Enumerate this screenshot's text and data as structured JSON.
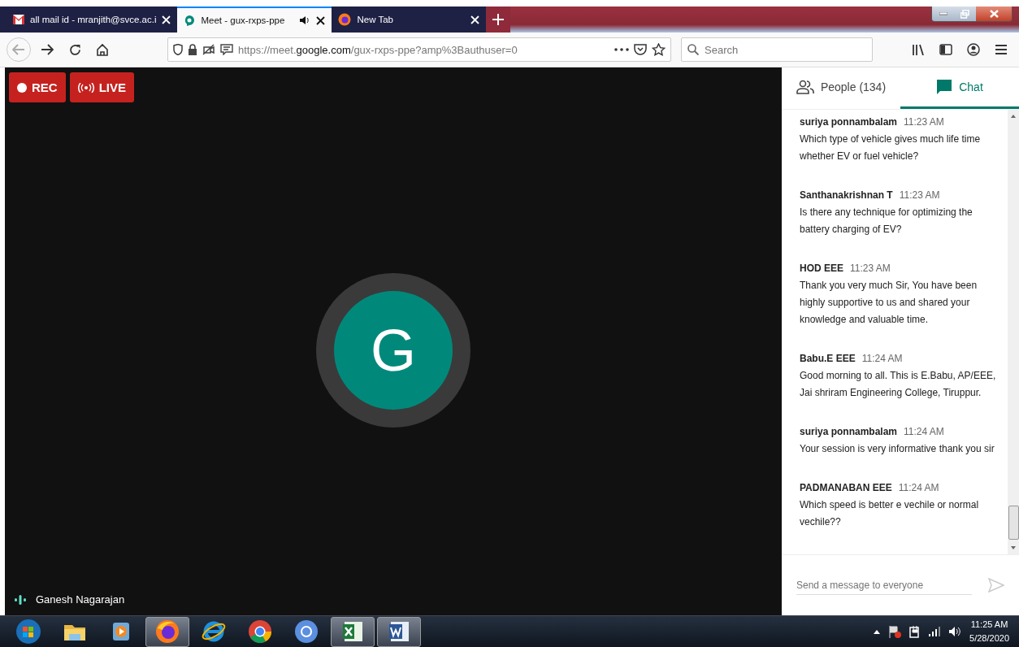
{
  "browser": {
    "tabs": [
      {
        "title": "all mail id - mranjith@svce.ac.i",
        "kind": "mail",
        "selected": false,
        "audio": false
      },
      {
        "title": "Meet - gux-rxps-ppe",
        "kind": "meet",
        "selected": true,
        "audio": true
      },
      {
        "title": "New Tab",
        "kind": "fox",
        "selected": false,
        "audio": false
      }
    ],
    "url": "https://meet.**google.com**/gux-rxps-ppe?amp%3Bauthuser=0",
    "search": {
      "placeholder": "Search"
    }
  },
  "meeting": {
    "rec_label": "REC",
    "live_label": "LIVE",
    "avatar_letter": "G",
    "speaker": "Ganesh Nagarajan"
  },
  "side_panel": {
    "tabs": [
      {
        "label": "People (134)",
        "kind": "people",
        "selected": false
      },
      {
        "label": "Chat",
        "kind": "chat",
        "selected": true
      }
    ],
    "messages": [
      {
        "sender": "suriya ponnambalam",
        "time": "11:23 AM",
        "text": "Which type of vehicle gives much life time whether EV or fuel vehicle?"
      },
      {
        "sender": "Santhanakrishnan T",
        "time": "11:23 AM",
        "text": "Is there any technique for optimizing the battery charging of EV?"
      },
      {
        "sender": "HOD EEE",
        "time": "11:23 AM",
        "text": "Thank you very much Sir, You have been highly supportive to us and shared your knowledge and valuable time."
      },
      {
        "sender": "Babu.E EEE",
        "time": "11:24 AM",
        "text": "Good morning to all. This is E.Babu, AP/EEE, Jai shriram Engineering College, Tiruppur."
      },
      {
        "sender": "suriya ponnambalam",
        "time": "11:24 AM",
        "text": "Your session is very informative thank you sir"
      },
      {
        "sender": "PADMANABAN EEE",
        "time": "11:24 AM",
        "text": "Which speed is better e vechile or normal vechile??"
      }
    ],
    "composer": {
      "placeholder": "Send a message to everyone"
    }
  },
  "taskbar": {
    "apps": [
      {
        "kind": "start",
        "running": false
      },
      {
        "kind": "folder",
        "running": false
      },
      {
        "kind": "player",
        "running": false
      },
      {
        "kind": "fox",
        "running": true
      },
      {
        "kind": "ebrowser",
        "running": false
      },
      {
        "kind": "chrome",
        "running": false
      },
      {
        "kind": "chromium",
        "running": false
      },
      {
        "kind": "sheet",
        "running": true
      },
      {
        "kind": "doc",
        "running": true
      }
    ],
    "clock": {
      "time": "11:25 AM",
      "date": "5/28/2020"
    }
  }
}
